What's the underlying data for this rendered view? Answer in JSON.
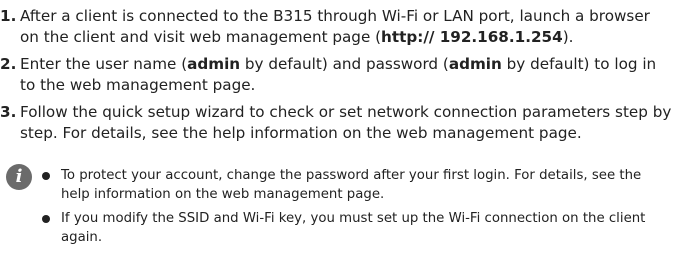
{
  "steps": [
    {
      "number": "1.",
      "parts": [
        "After a client is connected to the B315 through Wi-Fi or LAN port, launch a browser on the client and visit web management page (",
        "http:// 192.168.1.254",
        ")."
      ]
    },
    {
      "number": "2.",
      "parts": [
        "Enter the user name (",
        "admin",
        " by default) and password (",
        "admin",
        " by default) to log in to the web management page."
      ]
    },
    {
      "number": "3.",
      "text": "Follow the quick setup wizard to check or set network connection parameters step by step. For details, see the help information on the web management page."
    }
  ],
  "info_icon": {
    "glyph": "i",
    "icon": "info-icon"
  },
  "notes": [
    "To protect your account, change the password after your first login. For details, see the help information on the web management page.",
    "If you modify the SSID and Wi-Fi key, you must set up the Wi-Fi connection on the client again."
  ]
}
